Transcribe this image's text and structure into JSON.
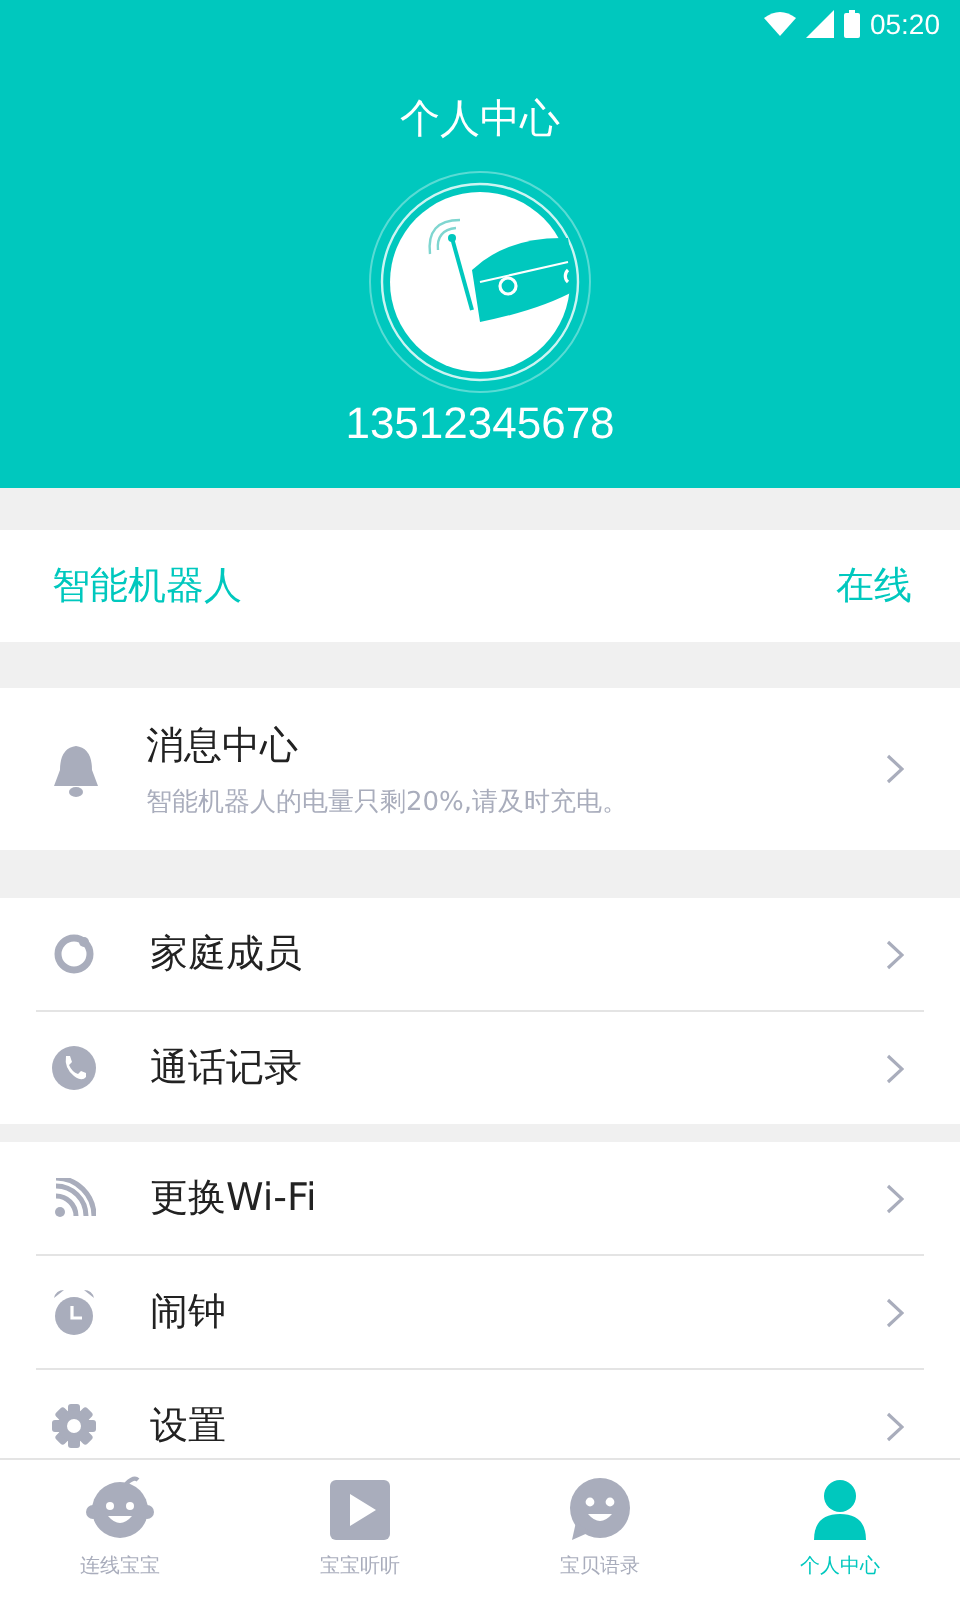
{
  "status_bar": {
    "time": "05:20"
  },
  "header": {
    "title": "个人中心",
    "phone": "13512345678"
  },
  "device": {
    "name": "智能机器人",
    "status": "在线"
  },
  "message": {
    "title": "消息中心",
    "text": "智能机器人的电量只剩20%,请及时充电。"
  },
  "groups": [
    {
      "items": [
        {
          "label": "家庭成员"
        },
        {
          "label": "通话记录"
        }
      ]
    },
    {
      "items": [
        {
          "label": "更换Wi-Fi"
        },
        {
          "label": "闹钟"
        },
        {
          "label": "设置"
        }
      ]
    }
  ],
  "tabs": [
    {
      "label": "连线宝宝",
      "selected": false
    },
    {
      "label": "宝宝听听",
      "selected": false
    },
    {
      "label": "宝贝语录",
      "selected": false
    },
    {
      "label": "个人中心",
      "selected": true
    }
  ]
}
